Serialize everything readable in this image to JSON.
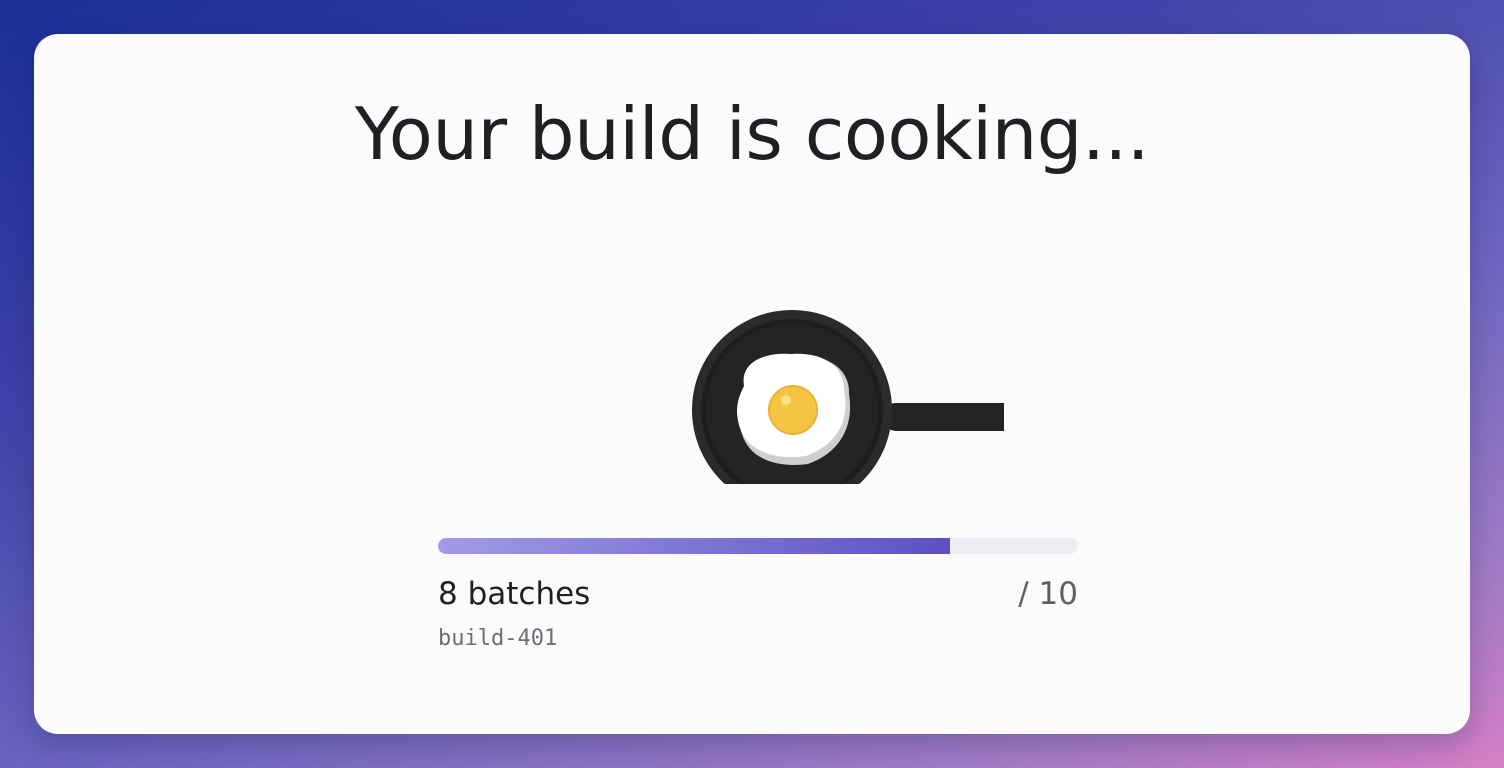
{
  "title": "Your build is cooking...",
  "illustration": {
    "icon": "frying-pan-with-egg-icon"
  },
  "progress": {
    "done_label": "8 batches",
    "total_label": "/ 10",
    "done": 8,
    "total": 10,
    "fraction": 0.8,
    "colors": {
      "fill_start": "#a39ae6",
      "fill_end": "#5e4fc2",
      "track": "#eeedf3"
    }
  },
  "build_id": "build-401"
}
